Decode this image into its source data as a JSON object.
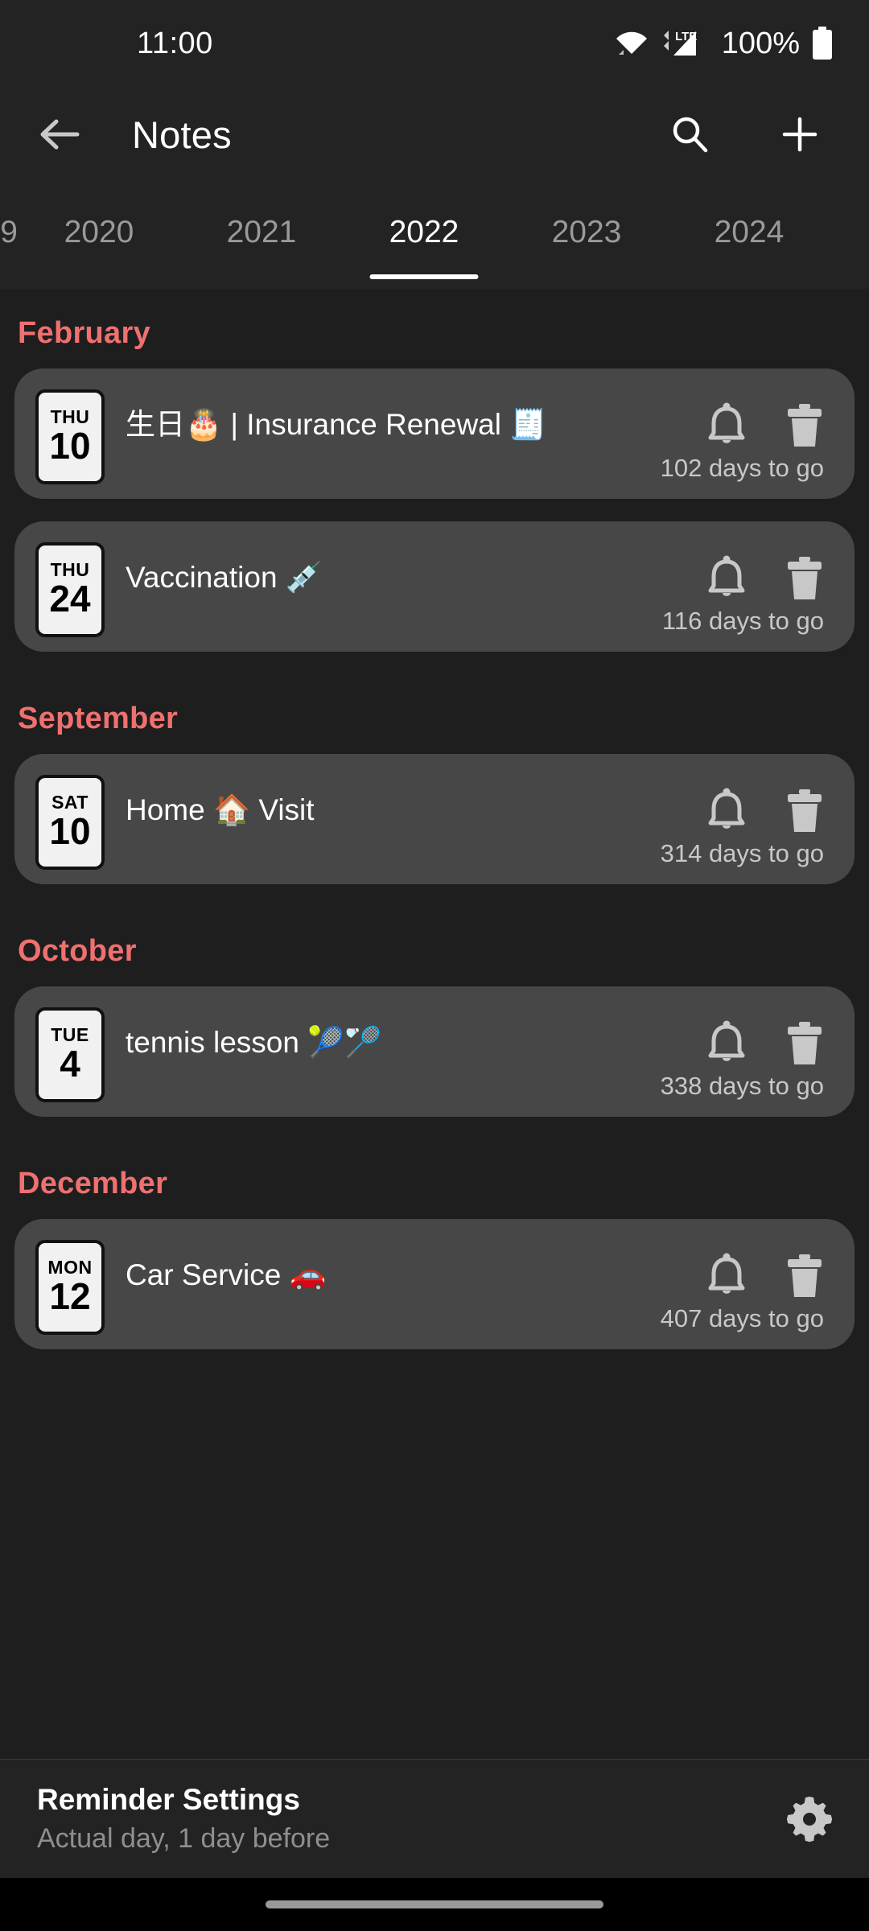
{
  "status_bar": {
    "time": "11:00",
    "battery_percent": "100%",
    "icons": [
      "wifi-icon",
      "lte-signal-icon",
      "battery-icon"
    ],
    "network_label": "LTE"
  },
  "app_bar": {
    "back_label": "back-arrow-icon",
    "title": "Notes",
    "search_label": "search-icon",
    "add_label": "plus-icon"
  },
  "year_tabs": {
    "partial_left": "9",
    "items": [
      {
        "label": "2020",
        "active": false
      },
      {
        "label": "2021",
        "active": false
      },
      {
        "label": "2022",
        "active": true
      },
      {
        "label": "2023",
        "active": false
      },
      {
        "label": "2024",
        "active": false
      }
    ]
  },
  "sections": [
    {
      "month": "February",
      "events": [
        {
          "dow": "THU",
          "day": "10",
          "title": "生日🎂 | Insurance Renewal 🧾",
          "days_to_go": "102 days to go",
          "bell": "bell-icon",
          "trash": "trash-icon"
        },
        {
          "dow": "THU",
          "day": "24",
          "title": "Vaccination 💉",
          "days_to_go": "116 days to go",
          "bell": "bell-icon",
          "trash": "trash-icon"
        }
      ]
    },
    {
      "month": "September",
      "events": [
        {
          "dow": "SAT",
          "day": "10",
          "title": "Home 🏠 Visit",
          "days_to_go": "314 days to go",
          "bell": "bell-icon",
          "trash": "trash-icon"
        }
      ]
    },
    {
      "month": "October",
      "events": [
        {
          "dow": "TUE",
          "day": "4",
          "title": "tennis lesson 🎾🏸",
          "days_to_go": "338 days to go",
          "bell": "bell-icon",
          "trash": "trash-icon"
        }
      ]
    },
    {
      "month": "December",
      "events": [
        {
          "dow": "MON",
          "day": "12",
          "title": "Car Service 🚗",
          "days_to_go": "407 days to go",
          "bell": "bell-icon",
          "trash": "trash-icon"
        }
      ]
    }
  ],
  "settings": {
    "title": "Reminder Settings",
    "subtitle": "Actual day, 1 day before",
    "gear": "gear-icon"
  },
  "colors": {
    "page_bg": "#1e1e1e",
    "bar_bg": "#232323",
    "card_bg": "#474747",
    "month_accent": "#f07070",
    "primary_text": "#ffffff",
    "secondary_text": "#c8c8c8",
    "muted_text": "#8f8f8f"
  }
}
